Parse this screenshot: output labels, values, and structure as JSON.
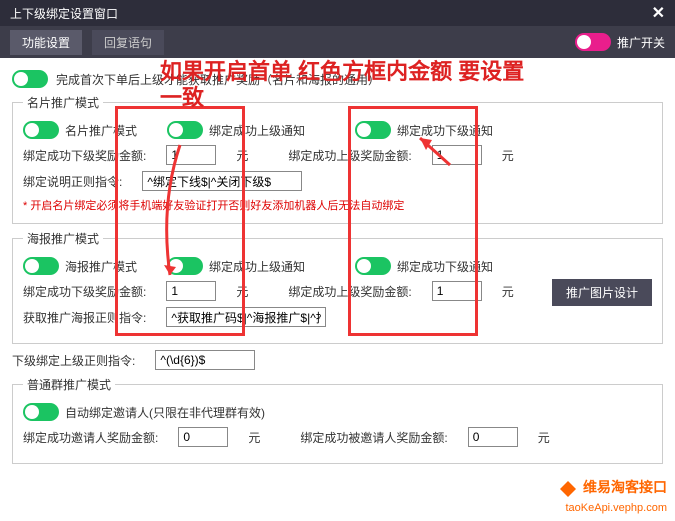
{
  "window": {
    "title": "上下级绑定设置窗口"
  },
  "tabs": {
    "func": "功能设置",
    "reply": "回复语句"
  },
  "mainToggle": "推广开关",
  "firstOrderNote": "完成首次下单后上级才能获取推广奖励（名片和海报的通用）",
  "overlay": {
    "l1": "如果开启首单  红色方框内金额  要设置",
    "l2": "一致"
  },
  "card": {
    "legend": "名片推广模式",
    "t1": "名片推广模式",
    "t2": "绑定成功上级通知",
    "t3": "绑定成功下级通知",
    "a1": "绑定成功下级奖励金额:",
    "a2": "绑定成功上级奖励金额:",
    "unit": "元",
    "v1": "1",
    "v2": "1",
    "rx": "绑定说明正则指令:",
    "rxv": "^绑定下线$|^关闭下级$",
    "warn": "* 开启名片绑定必须将手机端好友验证打开否则好友添加机器人后无法自动绑定"
  },
  "poster": {
    "legend": "海报推广模式",
    "t1": "海报推广模式",
    "t2": "绑定成功上级通知",
    "t3": "绑定成功下级通知",
    "a1": "绑定成功下级奖励金额:",
    "a2": "绑定成功上级奖励金额:",
    "unit": "元",
    "v1": "1",
    "v2": "1",
    "rx": "获取推广海报正则指令:",
    "rxv": "^获取推广码$|^海报推广$|^推广$",
    "btn": "推广图片设计"
  },
  "subregex": {
    "lbl": "下级绑定上级正则指令:",
    "val": "^(\\d{6})$"
  },
  "group": {
    "legend": "普通群推广模式",
    "t1": "自动绑定邀请人(只限在非代理群有效)",
    "a1": "绑定成功邀请人奖励金额:",
    "a2": "绑定成功被邀请人奖励金额:",
    "unit": "元",
    "v1": "0",
    "v2": "0"
  },
  "wm": {
    "l1": "维易淘客接口",
    "l2": "taoKeApi.vephp.com"
  }
}
